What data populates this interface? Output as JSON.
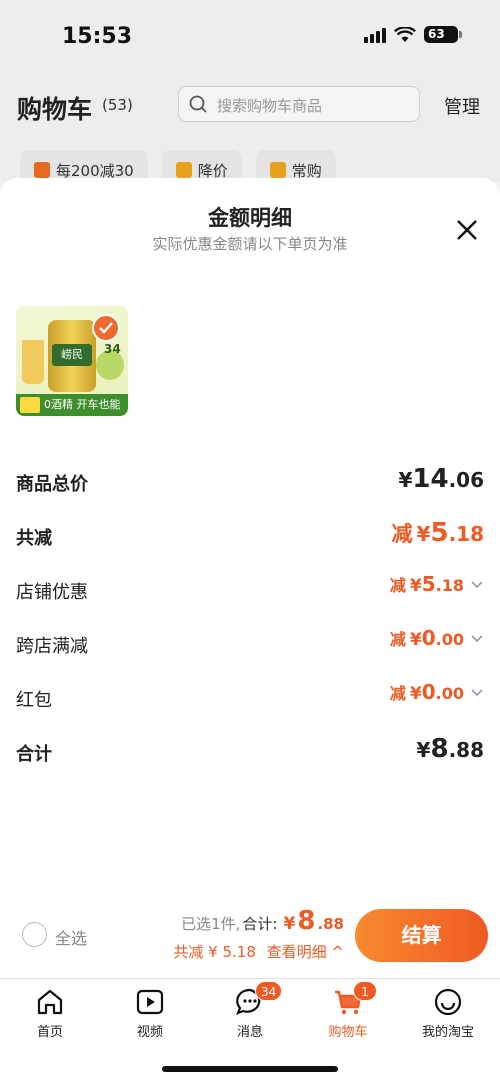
{
  "status_bar": {
    "time": "15:53",
    "battery": "63"
  },
  "header": {
    "title": "购物车",
    "count": "(53)",
    "search_placeholder": "搜索购物车商品",
    "manage": "管理",
    "chips": [
      "每200减30",
      "降价",
      "常购"
    ]
  },
  "sheet": {
    "title": "金额明细",
    "subtitle": "实际优惠金额请以下单页为准",
    "product": {
      "can_text": "崂民",
      "number": "34",
      "band_text": "0酒精 开车也能喝"
    },
    "rows": {
      "total_label": "商品总价",
      "total_cur": "¥",
      "total_int": "14",
      "total_dec": ".06",
      "discount_label": "共减",
      "discount_prefix": "减",
      "discount_cur": "¥",
      "discount_int": "5",
      "discount_dec": ".18",
      "store_label": "店铺优惠",
      "store_prefix": "减",
      "store_cur": "¥",
      "store_int": "5",
      "store_dec": ".18",
      "cross_label": "跨店满减",
      "cross_prefix": "减",
      "cross_cur": "¥",
      "cross_int": "0",
      "cross_dec": ".00",
      "redpack_label": "红包",
      "redpack_prefix": "减",
      "redpack_cur": "¥",
      "redpack_int": "0",
      "redpack_dec": ".00",
      "sum_label": "合计",
      "sum_cur": "¥",
      "sum_int": "8",
      "sum_dec": ".88"
    }
  },
  "bottom_bar": {
    "select_all": "全选",
    "selected_prefix": "已选1件,",
    "total_label": "合计:",
    "cur": "¥",
    "int": "8",
    "dec": ".88",
    "discount_text": "共减 ¥ 5.18",
    "detail_link": "查看明细 ^",
    "checkout": "结算"
  },
  "tabs": [
    {
      "label": "首页",
      "icon": "home-icon"
    },
    {
      "label": "视频",
      "icon": "video-icon"
    },
    {
      "label": "消息",
      "icon": "message-icon",
      "badge": "34"
    },
    {
      "label": "购物车",
      "icon": "cart-icon",
      "badge": "1",
      "active": true
    },
    {
      "label": "我的淘宝",
      "icon": "profile-icon"
    }
  ],
  "colors": {
    "accent": "#ef5a24",
    "accent_light": "#f78a2f"
  }
}
